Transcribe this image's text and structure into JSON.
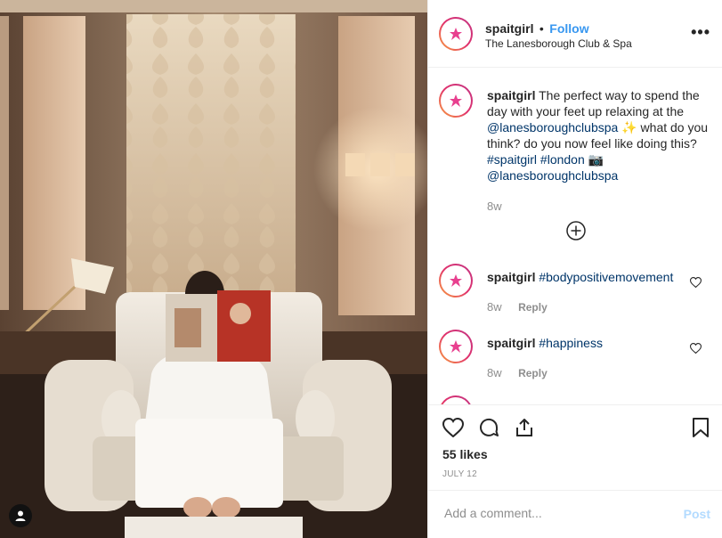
{
  "post": {
    "username": "spaitgirl",
    "separator": "•",
    "follow_label": "Follow",
    "location": "The Lanesborough Club & Spa",
    "more_icon": "ellipsis-icon"
  },
  "caption": {
    "username": "spaitgirl",
    "text_1": "The perfect way to spend the day with your feet up relaxing at the",
    "mention_1": "@lanesboroughclubspa",
    "emoji_1": "✨",
    "text_2": "what do you think? do you now feel like doing this?",
    "hashtag_1": "#spaitgirl",
    "hashtag_2": "#london",
    "emoji_2": "📷",
    "mention_2": "@lanesboroughclubspa",
    "time": "8w"
  },
  "load_more_icon": "plus-circle-icon",
  "comments": [
    {
      "username": "spaitgirl",
      "text": "#bodypositivemovement",
      "time": "8w",
      "reply_label": "Reply"
    },
    {
      "username": "spaitgirl",
      "text": "#happiness",
      "time": "8w",
      "reply_label": "Reply"
    }
  ],
  "actions": {
    "likes": "55 likes",
    "date": "JULY 12"
  },
  "add_comment": {
    "placeholder": "Add a comment...",
    "post_label": "Post"
  },
  "colors": {
    "link": "#003569",
    "follow": "#3897f0",
    "muted": "#8e8e8e",
    "post_disabled": "#b3dbff",
    "avatar_logo": "#e8408f"
  }
}
